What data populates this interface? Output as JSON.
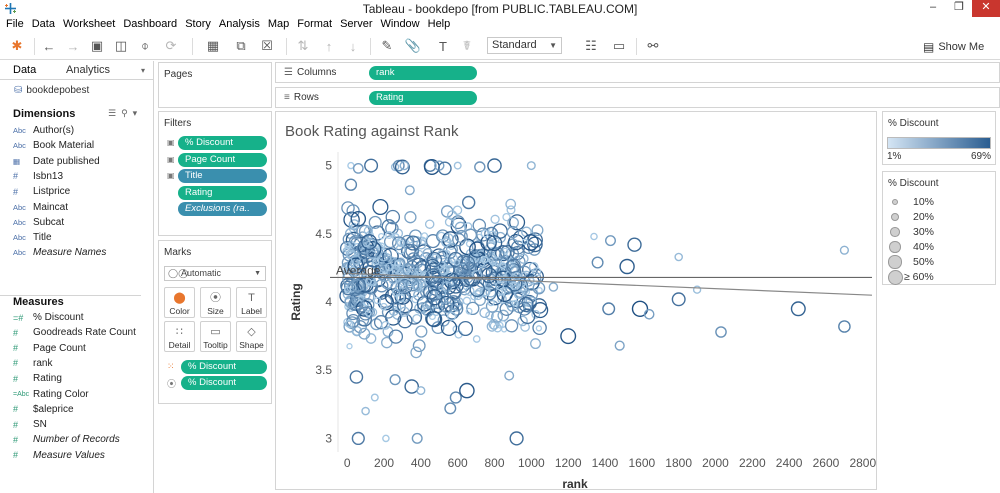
{
  "window": {
    "title": "Tableau - bookdepo [from PUBLIC.TABLEAU.COM]"
  },
  "menu": [
    "File",
    "Data",
    "Worksheet",
    "Dashboard",
    "Story",
    "Analysis",
    "Map",
    "Format",
    "Server",
    "Window",
    "Help"
  ],
  "toolbar": {
    "fit": "Standard",
    "show_me": "Show Me"
  },
  "data_pane": {
    "tabs": [
      "Data",
      "Analytics"
    ],
    "datasource": "bookdepobest",
    "dimensions_title": "Dimensions",
    "dimensions": [
      {
        "icon": "Abc",
        "label": "Author(s)"
      },
      {
        "icon": "Abc",
        "label": "Book Material"
      },
      {
        "icon": "calendar",
        "label": "Date published"
      },
      {
        "icon": "#",
        "label": "Isbn13"
      },
      {
        "icon": "#",
        "label": "Listprice"
      },
      {
        "icon": "Abc",
        "label": "Maincat"
      },
      {
        "icon": "Abc",
        "label": "Subcat"
      },
      {
        "icon": "Abc",
        "label": "Title"
      },
      {
        "icon": "Abc",
        "label": "Measure Names"
      }
    ],
    "measures_title": "Measures",
    "measures": [
      {
        "icon": "=#",
        "label": "% Discount"
      },
      {
        "icon": "#",
        "label": "Goodreads Rate Count"
      },
      {
        "icon": "#",
        "label": "Page Count"
      },
      {
        "icon": "#",
        "label": "rank"
      },
      {
        "icon": "#",
        "label": "Rating"
      },
      {
        "icon": "=Abc",
        "label": "Rating Color"
      },
      {
        "icon": "#",
        "label": "$aleprice"
      },
      {
        "icon": "#",
        "label": "SN"
      },
      {
        "icon": "#",
        "label": "Number of Records"
      },
      {
        "icon": "#",
        "label": "Measure Values"
      }
    ]
  },
  "cards": {
    "pages_title": "Pages",
    "filters_title": "Filters",
    "filters": [
      "% Discount",
      "Page Count",
      "Title",
      "Rating",
      "Exclusions (ra.."
    ],
    "marks_title": "Marks",
    "mark_type": "Automatic",
    "mark_buttons": [
      "Color",
      "Size",
      "Label",
      "Detail",
      "Tooltip",
      "Shape"
    ],
    "mark_pills": [
      "% Discount",
      "% Discount"
    ]
  },
  "shelves": {
    "columns_label": "Columns",
    "columns_pill": "rank",
    "rows_label": "Rows",
    "rows_pill": "Rating"
  },
  "legends": {
    "color_title": "% Discount",
    "color_min": "1%",
    "color_max": "69%",
    "color_range": [
      "#d4e5f4",
      "#2a5d91"
    ],
    "size_title": "% Discount",
    "size_items": [
      "10%",
      "20%",
      "30%",
      "40%",
      "50%",
      "≥ 60%"
    ]
  },
  "chart_data": {
    "type": "scatter",
    "title": "Book Rating against Rank",
    "xlabel": "rank",
    "ylabel": "Rating",
    "xlim": [
      -50,
      2850
    ],
    "ylim": [
      2.9,
      5.1
    ],
    "xticks": [
      0,
      200,
      400,
      600,
      800,
      1000,
      1200,
      1400,
      1600,
      1800,
      2000,
      2200,
      2400,
      2600,
      2800
    ],
    "yticks": [
      3.0,
      3.5,
      4.0,
      4.5,
      5.0
    ],
    "reference_line": {
      "label": "Average",
      "value": 4.18
    },
    "trend_line": {
      "x": [
        0,
        2850
      ],
      "y": [
        4.21,
        4.05
      ]
    },
    "color_field": "% Discount",
    "size_field": "% Discount",
    "notable_points": [
      {
        "x": 20,
        "y": 5.0
      },
      {
        "x": 60,
        "y": 4.98
      },
      {
        "x": 130,
        "y": 5.0
      },
      {
        "x": 260,
        "y": 4.99
      },
      {
        "x": 280,
        "y": 5.0
      },
      {
        "x": 300,
        "y": 4.99
      },
      {
        "x": 310,
        "y": 5.0
      },
      {
        "x": 450,
        "y": 5.0
      },
      {
        "x": 460,
        "y": 4.99
      },
      {
        "x": 500,
        "y": 5.0
      },
      {
        "x": 530,
        "y": 4.98
      },
      {
        "x": 600,
        "y": 5.0
      },
      {
        "x": 720,
        "y": 4.99
      },
      {
        "x": 800,
        "y": 5.0
      },
      {
        "x": 1000,
        "y": 5.0
      },
      {
        "x": 20,
        "y": 4.86
      },
      {
        "x": 60,
        "y": 4.61
      },
      {
        "x": 340,
        "y": 4.82
      },
      {
        "x": 660,
        "y": 4.73
      },
      {
        "x": 1340,
        "y": 4.48
      },
      {
        "x": 1430,
        "y": 4.45
      },
      {
        "x": 1560,
        "y": 4.42
      },
      {
        "x": 1800,
        "y": 4.33
      },
      {
        "x": 1360,
        "y": 4.29
      },
      {
        "x": 1520,
        "y": 4.26
      },
      {
        "x": 1120,
        "y": 4.11
      },
      {
        "x": 1420,
        "y": 3.95
      },
      {
        "x": 1590,
        "y": 3.95
      },
      {
        "x": 1640,
        "y": 3.91
      },
      {
        "x": 1800,
        "y": 4.02
      },
      {
        "x": 1900,
        "y": 4.09
      },
      {
        "x": 2030,
        "y": 3.78
      },
      {
        "x": 2450,
        "y": 3.95
      },
      {
        "x": 2700,
        "y": 4.38
      },
      {
        "x": 2700,
        "y": 3.82
      },
      {
        "x": 1200,
        "y": 3.75
      },
      {
        "x": 1480,
        "y": 3.68
      },
      {
        "x": 50,
        "y": 3.45
      },
      {
        "x": 150,
        "y": 3.3
      },
      {
        "x": 260,
        "y": 3.43
      },
      {
        "x": 350,
        "y": 3.38
      },
      {
        "x": 400,
        "y": 3.35
      },
      {
        "x": 590,
        "y": 3.3
      },
      {
        "x": 650,
        "y": 3.35
      },
      {
        "x": 880,
        "y": 3.46
      },
      {
        "x": 60,
        "y": 3.0
      },
      {
        "x": 210,
        "y": 3.0
      },
      {
        "x": 380,
        "y": 3.0
      },
      {
        "x": 920,
        "y": 3.0
      },
      {
        "x": 100,
        "y": 3.2
      },
      {
        "x": 560,
        "y": 3.22
      }
    ]
  }
}
